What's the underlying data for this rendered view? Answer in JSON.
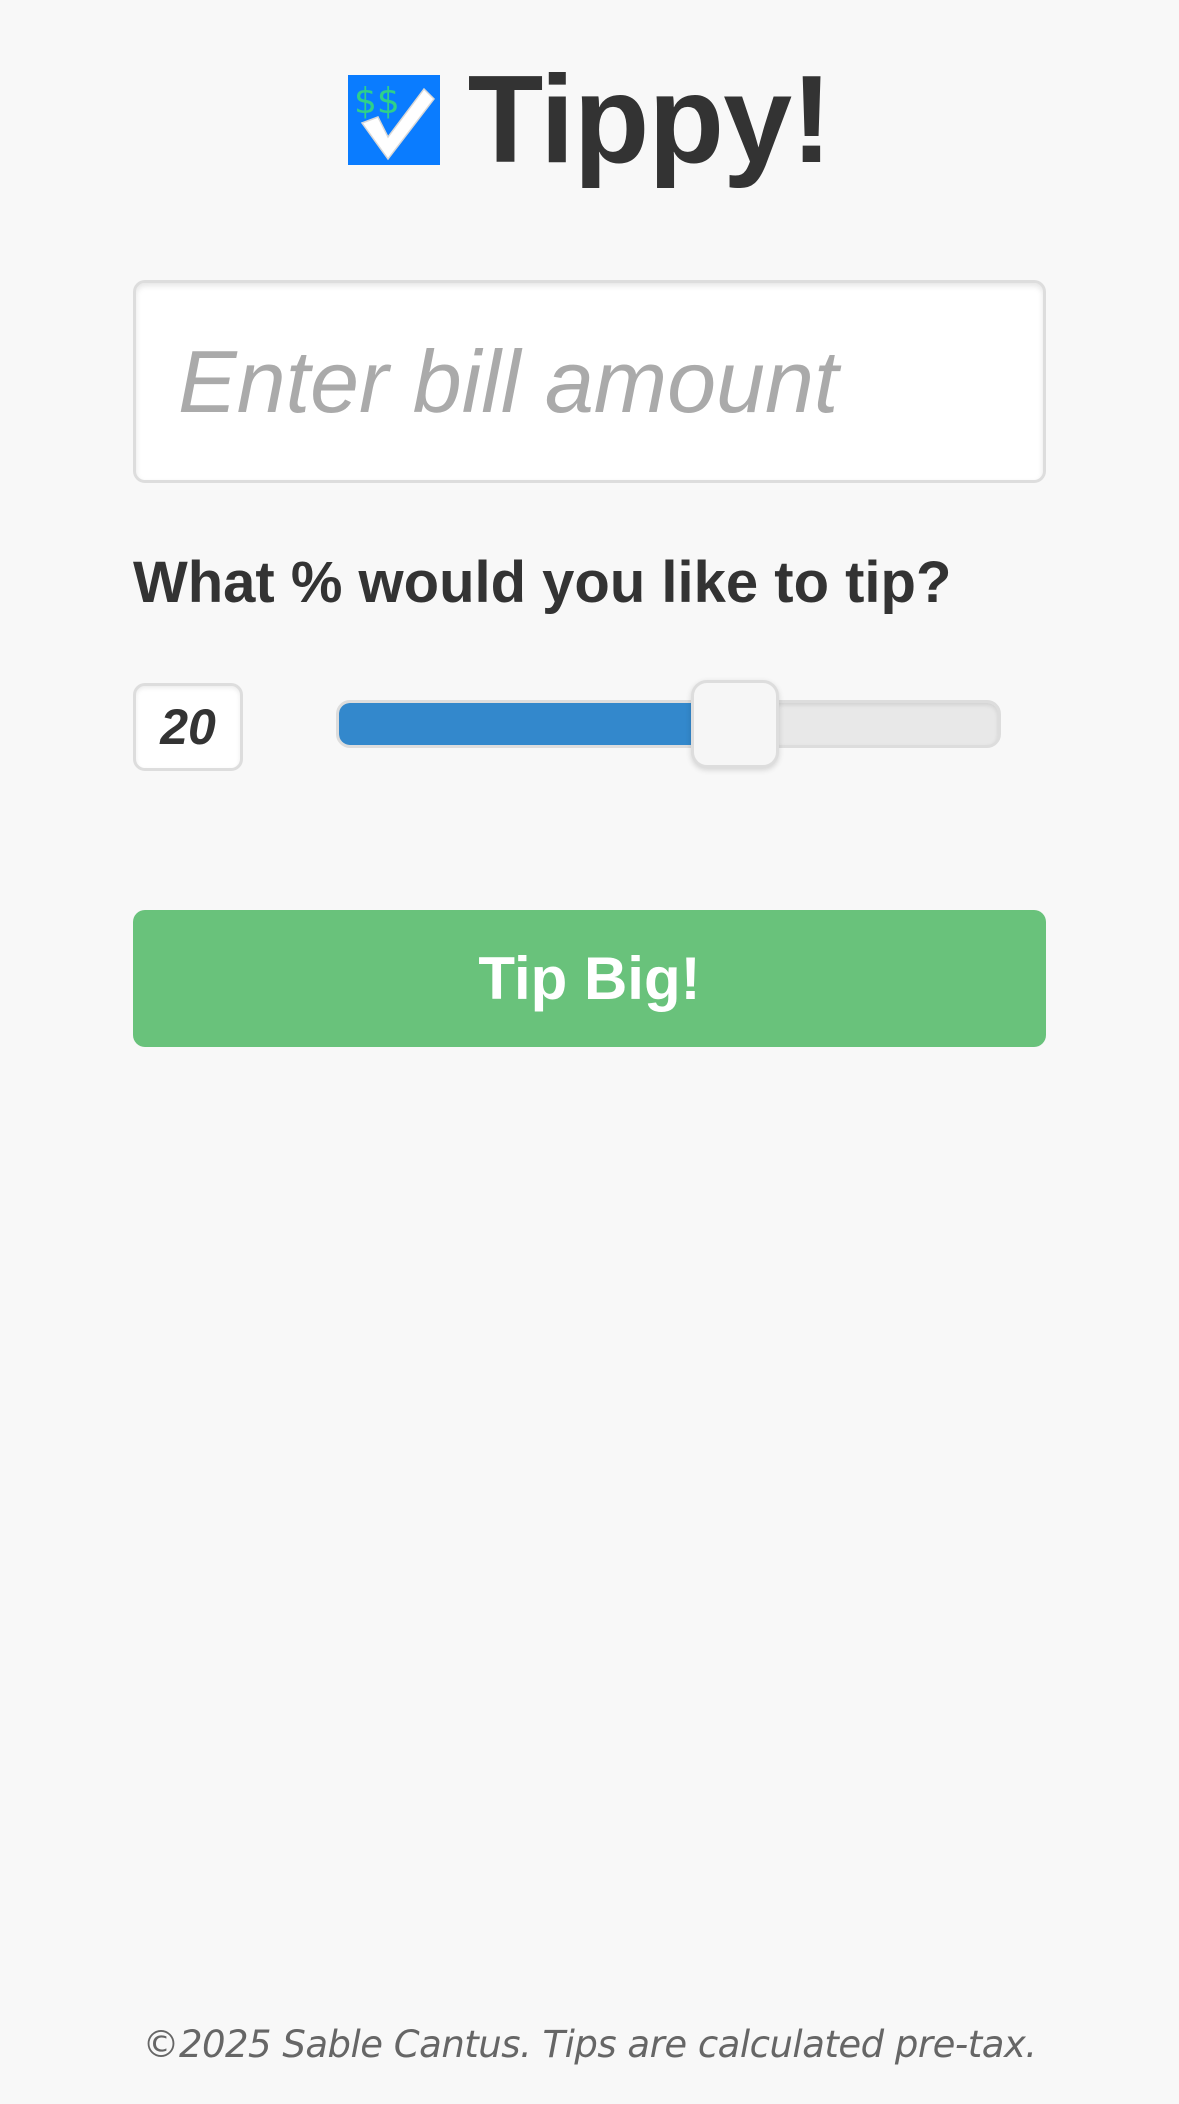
{
  "header": {
    "logo_icon": "heavy-dollar-check-icon",
    "title": "Tippy!"
  },
  "bill": {
    "placeholder": "Enter bill amount",
    "value": ""
  },
  "tip": {
    "question": "What % would you like to tip?",
    "percent": "20",
    "slider_level": 0.6,
    "slider_fill_color": "#3388cc"
  },
  "action": {
    "label": "Tip Big!",
    "color": "#69c27b"
  },
  "footer": {
    "text": "©2025 Sable Cantus. Tips are calculated pre-tax."
  },
  "colors": {
    "background": "#f8f8f8",
    "text": "#333333",
    "logo_blue": "#0a7cff",
    "logo_dollar": "#2fd08a"
  }
}
